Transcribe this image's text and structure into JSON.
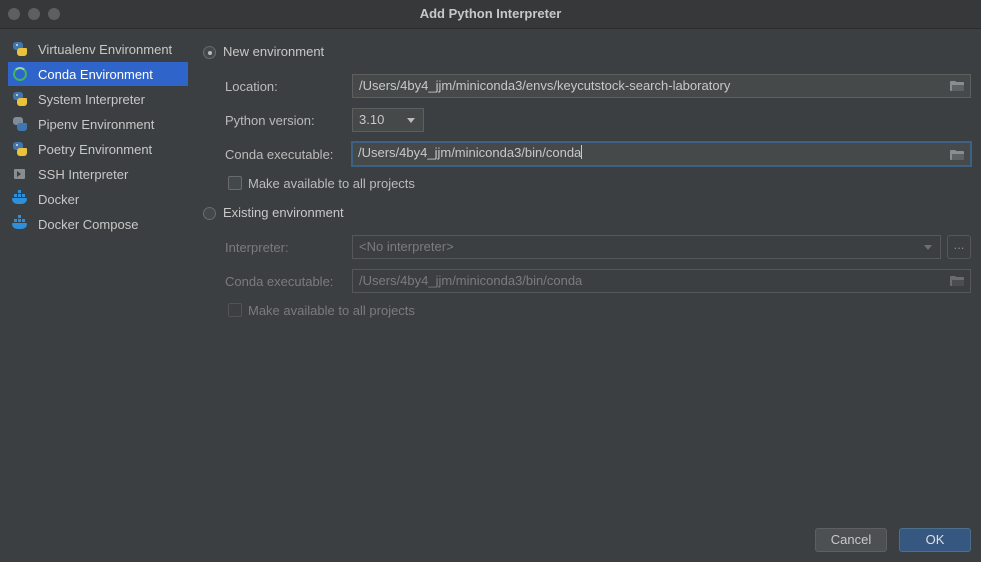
{
  "window": {
    "title": "Add Python Interpreter"
  },
  "sidebar": {
    "items": [
      {
        "label": "Virtualenv Environment",
        "icon": "python-icon"
      },
      {
        "label": "Conda Environment",
        "icon": "conda-icon",
        "selected": true
      },
      {
        "label": "System Interpreter",
        "icon": "python-icon"
      },
      {
        "label": "Pipenv Environment",
        "icon": "pipenv-icon"
      },
      {
        "label": "Poetry Environment",
        "icon": "python-icon"
      },
      {
        "label": "SSH Interpreter",
        "icon": "ssh-icon"
      },
      {
        "label": "Docker",
        "icon": "docker-icon"
      },
      {
        "label": "Docker Compose",
        "icon": "docker-icon"
      }
    ]
  },
  "new_env": {
    "radio_label": "New environment",
    "selected": true,
    "location_label": "Location:",
    "location_value": "/Users/4by4_jjm/miniconda3/envs/keycutstock-search-laboratory",
    "python_version_label": "Python version:",
    "python_version_value": "3.10",
    "conda_exec_label": "Conda executable:",
    "conda_exec_value": "/Users/4by4_jjm/miniconda3/bin/conda",
    "make_available_label": "Make available to all projects"
  },
  "existing_env": {
    "radio_label": "Existing environment",
    "selected": false,
    "interpreter_label": "Interpreter:",
    "interpreter_value": "<No interpreter>",
    "ellipsis": "...",
    "conda_exec_label": "Conda executable:",
    "conda_exec_value": "/Users/4by4_jjm/miniconda3/bin/conda",
    "make_available_label": "Make available to all projects"
  },
  "footer": {
    "cancel_label": "Cancel",
    "ok_label": "OK"
  }
}
